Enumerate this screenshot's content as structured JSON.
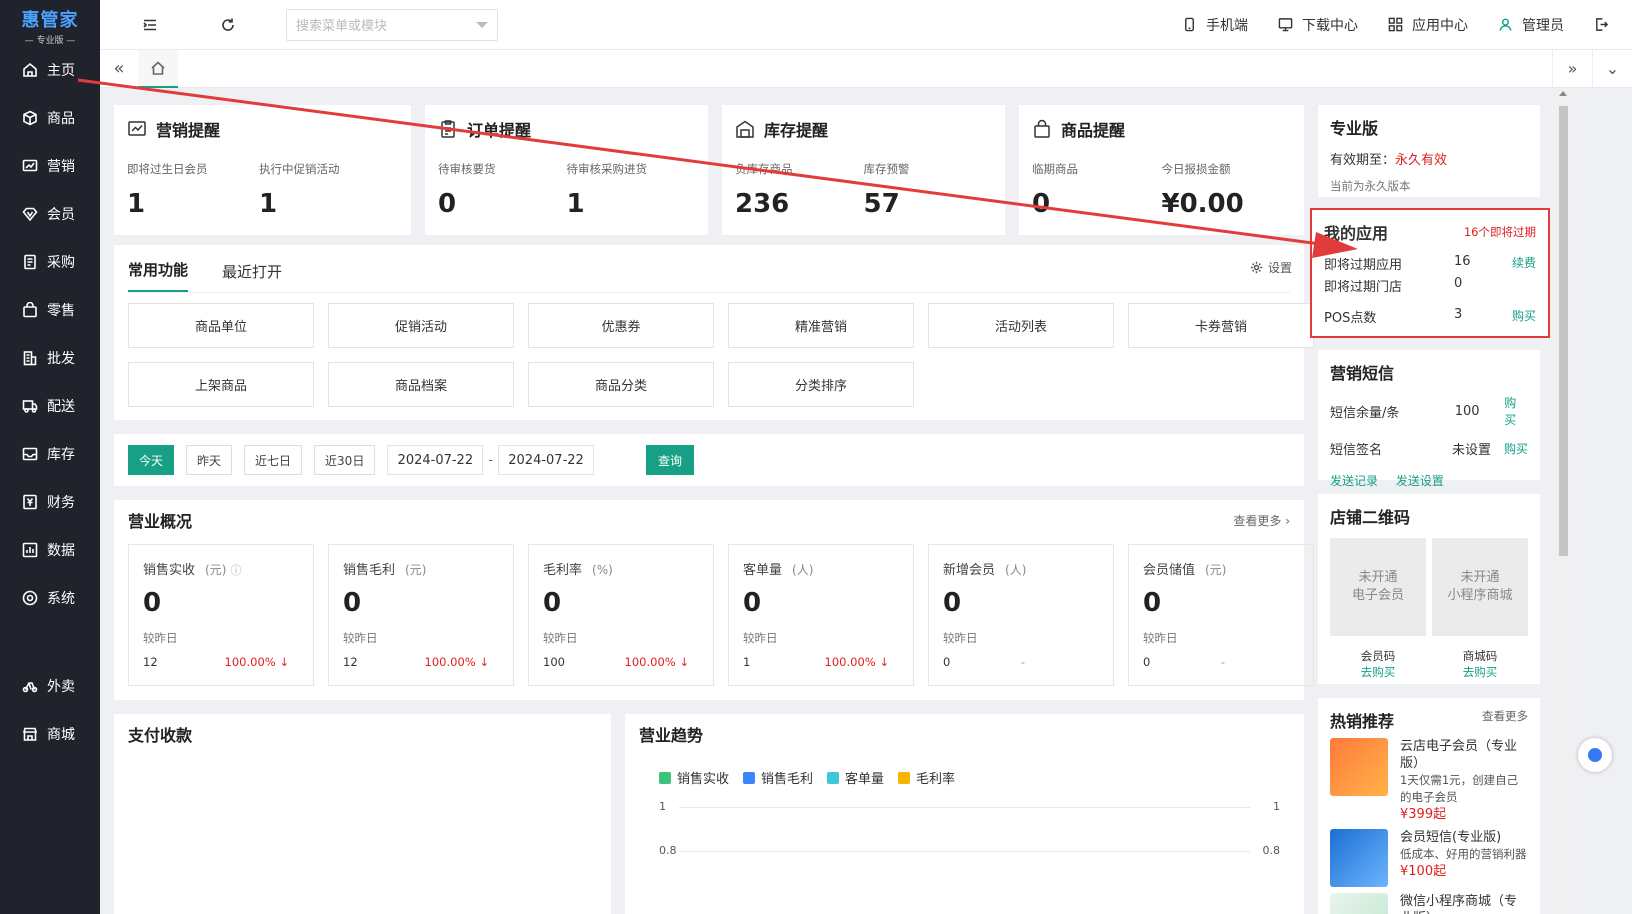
{
  "logo": {
    "name": "惠管家",
    "edition": "— 专业版 —"
  },
  "sidebar": {
    "items": [
      {
        "label": "主页",
        "icon": "home-icon"
      },
      {
        "label": "商品",
        "icon": "cube-icon"
      },
      {
        "label": "营销",
        "icon": "chart-icon"
      },
      {
        "label": "会员",
        "icon": "diamond-icon"
      },
      {
        "label": "采购",
        "icon": "receipt-icon"
      },
      {
        "label": "零售",
        "icon": "bag-icon"
      },
      {
        "label": "批发",
        "icon": "building-icon"
      },
      {
        "label": "配送",
        "icon": "truck-icon"
      },
      {
        "label": "库存",
        "icon": "inbox-icon"
      },
      {
        "label": "财务",
        "icon": "money-icon"
      },
      {
        "label": "数据",
        "icon": "bar-chart-icon"
      },
      {
        "label": "系统",
        "icon": "settings-icon"
      },
      {
        "label": "外卖",
        "icon": "scooter-icon"
      },
      {
        "label": "商城",
        "icon": "shop-icon"
      }
    ]
  },
  "topbar": {
    "search_placeholder": "搜索菜单或模块",
    "links": [
      {
        "label": "手机端",
        "icon": "mobile-icon"
      },
      {
        "label": "下载中心",
        "icon": "monitor-icon"
      },
      {
        "label": "应用中心",
        "icon": "apps-icon"
      },
      {
        "label": "管理员",
        "icon": "user-icon"
      }
    ]
  },
  "reminders": [
    {
      "title": "营销提醒",
      "icon": "trend-icon",
      "items": [
        {
          "label": "即将过生日会员",
          "value": "1"
        },
        {
          "label": "执行中促销活动",
          "value": "1"
        }
      ]
    },
    {
      "title": "订单提醒",
      "icon": "clipboard-icon",
      "items": [
        {
          "label": "待审核要货",
          "value": "0"
        },
        {
          "label": "待审核采购进货",
          "value": "1"
        }
      ]
    },
    {
      "title": "库存提醒",
      "icon": "warehouse-icon",
      "items": [
        {
          "label": "负库存商品",
          "value": "236"
        },
        {
          "label": "库存预警",
          "value": "57"
        }
      ]
    },
    {
      "title": "商品提醒",
      "icon": "shopping-bag-icon",
      "items": [
        {
          "label": "临期商品",
          "value": "0"
        },
        {
          "label": "今日报损金额",
          "value": "¥0.00"
        }
      ]
    }
  ],
  "common": {
    "tabs": [
      "常用功能",
      "最近打开"
    ],
    "settings_label": "设置",
    "functions": [
      "商品单位",
      "促销活动",
      "优惠券",
      "精准营销",
      "活动列表",
      "卡券营销",
      "上架商品",
      "商品档案",
      "商品分类",
      "分类排序"
    ]
  },
  "datebar": {
    "buttons": [
      "今天",
      "昨天",
      "近七日",
      "近30日"
    ],
    "start": "2024-07-22",
    "end": "2024-07-22",
    "separator": "-",
    "query": "查询"
  },
  "overview": {
    "title": "营业概况",
    "more": "查看更多 ›",
    "compare_label": "较昨日",
    "stats": [
      {
        "label": "销售实收",
        "unit": "(元)",
        "value": "0",
        "prev": "12",
        "change": "100.00% ↓"
      },
      {
        "label": "销售毛利",
        "unit": "(元)",
        "value": "0",
        "prev": "12",
        "change": "100.00% ↓"
      },
      {
        "label": "毛利率",
        "unit": "(%)",
        "value": "0",
        "prev": "100",
        "change": "100.00% ↓"
      },
      {
        "label": "客单量",
        "unit": "(人)",
        "value": "0",
        "prev": "1",
        "change": "100.00% ↓"
      },
      {
        "label": "新增会员",
        "unit": "(人)",
        "value": "0",
        "prev": "0",
        "change": "-"
      },
      {
        "label": "会员储值",
        "unit": "(元)",
        "value": "0",
        "prev": "0",
        "change": "-"
      }
    ]
  },
  "pay": {
    "title": "支付收款"
  },
  "trend": {
    "title": "营业趋势",
    "legend": [
      {
        "name": "销售实收",
        "color": "#3cc27b"
      },
      {
        "name": "销售毛利",
        "color": "#3a86ff"
      },
      {
        "name": "客单量",
        "color": "#3cc8d8"
      },
      {
        "name": "毛利率",
        "color": "#f5b400"
      }
    ],
    "ticks": [
      "1",
      "0.8"
    ]
  },
  "right": {
    "edition": {
      "title": "专业版",
      "valid_label": "有效期至：",
      "valid_value": "永久有效",
      "note": "当前为永久版本"
    },
    "myapps": {
      "title": "我的应用",
      "badge": "16个即将过期",
      "rows": [
        {
          "k": "即将过期应用",
          "v": "16",
          "a": "续费"
        },
        {
          "k": "即将过期门店",
          "v": "0",
          "a": ""
        },
        {
          "k": "POS点数",
          "v": "3",
          "a": "购买"
        }
      ]
    },
    "sms": {
      "title": "营销短信",
      "rows": [
        {
          "k": "短信余量/条",
          "v": "100",
          "a": "购买"
        },
        {
          "k": "短信签名",
          "v": "未设置",
          "a": "购买"
        }
      ],
      "links": [
        "发送记录",
        "发送设置"
      ]
    },
    "qr": {
      "title": "店铺二维码",
      "items": [
        {
          "box": "未开通\n电子会员",
          "name": "会员码",
          "action": "去购买"
        },
        {
          "box": "未开通\n小程序商城",
          "name": "商城码",
          "action": "去购买"
        }
      ]
    },
    "hot": {
      "title": "热销推荐",
      "more": "查看更多",
      "items": [
        {
          "name": "云店电子会员（专业版）",
          "desc": "1天仅需1元，创建自己的电子会员",
          "price": "¥399起"
        },
        {
          "name": "会员短信(专业版)",
          "desc": "低成本、好用的营销利器",
          "price": "¥100起"
        },
        {
          "name": "微信小程序商城（专业版）",
          "desc": "",
          "price": ""
        }
      ]
    }
  },
  "colors": {
    "accent": "#17a085",
    "sidebar": "#20232b",
    "alert": "#e23b3b"
  }
}
